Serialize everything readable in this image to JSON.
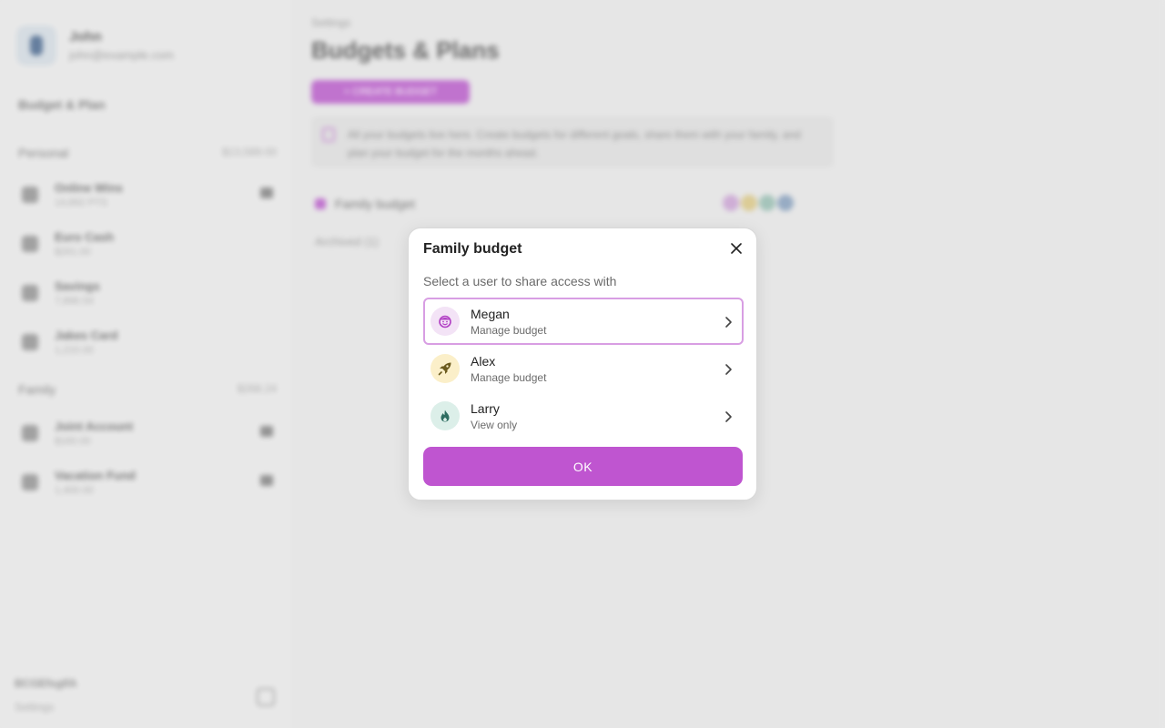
{
  "sidebar": {
    "profile": {
      "name": "John",
      "email": "john@example.com"
    },
    "heading": "Budget & Plan",
    "sections": [
      {
        "label": "Personal",
        "amount": "$13,589.00"
      },
      {
        "label": "Family",
        "amount": "$268.24"
      }
    ],
    "personal_items": [
      {
        "title": "Online Wins",
        "sub": "14,892 PTS"
      },
      {
        "title": "Euro Cash",
        "sub": "$261.00"
      },
      {
        "title": "Savings",
        "sub": "7,896.54"
      },
      {
        "title": "Jakes Card",
        "sub": "1,210.00"
      }
    ],
    "family_items": [
      {
        "title": "Joint Account",
        "sub": "$160.00"
      },
      {
        "title": "Vacation Fund",
        "sub": "1,400.00"
      }
    ],
    "footer": {
      "id": "BCGEfsgIfA",
      "settings": "Settings"
    }
  },
  "main": {
    "breadcrumb": "Settings",
    "title": "Budgets & Plans",
    "create_label": "+ CREATE BUDGET",
    "info_text": "All your budgets live here. Create budgets for different goals, share them with your family, and plan your budget for the months ahead.",
    "budget_name": "Family budget",
    "archived_label": "Archived (1)"
  },
  "modal": {
    "title": "Family budget",
    "subtitle": "Select a user to share access with",
    "users": [
      {
        "name": "Megan",
        "role": "Manage budget",
        "icon": "smiley-icon",
        "avatar_bg": "#f3e3f6",
        "icon_color": "#b13fc4"
      },
      {
        "name": "Alex",
        "role": "Manage budget",
        "icon": "rocket-icon",
        "avatar_bg": "#fbefc9",
        "icon_color": "#6b5a1d"
      },
      {
        "name": "Larry",
        "role": "View only",
        "icon": "fire-icon",
        "avatar_bg": "#dcefe9",
        "icon_color": "#2f6e62"
      }
    ],
    "ok_label": "OK",
    "close_icon": "close-icon",
    "accent": "#bf55d0"
  }
}
